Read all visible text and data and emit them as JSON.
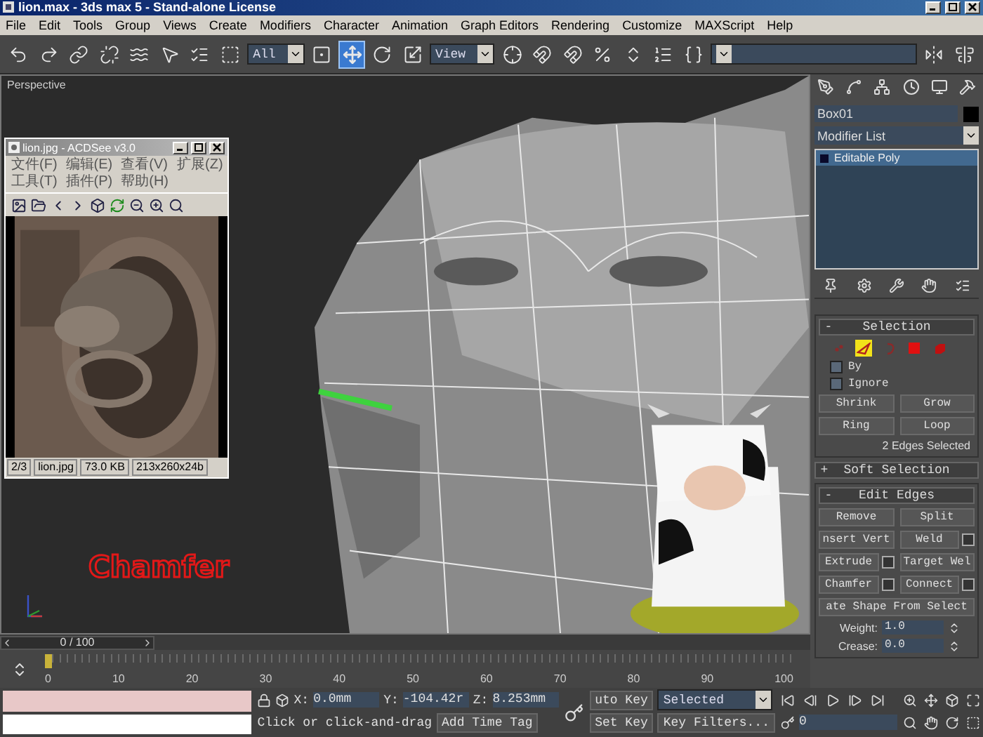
{
  "window": {
    "title": "lion.max - 3ds max 5 - Stand-alone License"
  },
  "menu": [
    "File",
    "Edit",
    "Tools",
    "Group",
    "Views",
    "Create",
    "Modifiers",
    "Character",
    "Animation",
    "Graph Editors",
    "Rendering",
    "Customize",
    "MAXScript",
    "Help"
  ],
  "toolbar": [
    {
      "kind": "undo",
      "selected": false
    },
    {
      "kind": "redo",
      "selected": false
    },
    {
      "kind": "link",
      "selected": false
    },
    {
      "kind": "unlink",
      "selected": false
    },
    {
      "kind": "bind",
      "selected": false
    },
    {
      "kind": "select",
      "selected": false
    },
    {
      "kind": "select-by-name",
      "selected": false
    },
    {
      "kind": "region",
      "selected": false
    },
    {
      "kind": "dropdown",
      "value": "All"
    },
    {
      "kind": "crossing",
      "selected": false
    },
    {
      "kind": "move",
      "selected": true
    },
    {
      "kind": "rotate",
      "selected": false
    },
    {
      "kind": "scale",
      "selected": false
    },
    {
      "kind": "dropdown",
      "value": "View"
    },
    {
      "kind": "pivot",
      "selected": false
    },
    {
      "kind": "snap",
      "selected": false
    },
    {
      "kind": "angle-snap",
      "selected": false
    },
    {
      "kind": "percent-snap",
      "selected": false
    },
    {
      "kind": "spinner-snap",
      "selected": false
    },
    {
      "kind": "named-sets",
      "selected": false
    },
    {
      "kind": "braces",
      "selected": false
    },
    {
      "kind": "dropdown"
    },
    {
      "kind": "mirror",
      "selected": false
    },
    {
      "kind": "align",
      "selected": false
    }
  ],
  "viewport": {
    "label": "Perspective",
    "overlay_text": "Chamfer"
  },
  "image_viewer": {
    "title": "lion.jpg - ACDSee v3.0",
    "menu": [
      "文件(F)",
      "编辑(E)",
      "查看(V)",
      "扩展(Z)",
      "工具(T)",
      "插件(P)",
      "帮助(H)"
    ],
    "status": [
      "2/3",
      "lion.jpg",
      "73.0 KB",
      "213x260x24b"
    ]
  },
  "command_panel": {
    "object_name": "Box01",
    "modifier_list": "Modifier List",
    "stack": [
      {
        "label": "Editable Poly",
        "selected": true
      }
    ],
    "selection": {
      "sign": "-",
      "title": "Selection",
      "levels": [
        {
          "kind": "vertex",
          "selected": false
        },
        {
          "kind": "edge",
          "selected": true
        },
        {
          "kind": "border",
          "selected": false
        },
        {
          "kind": "polygon",
          "selected": false
        },
        {
          "kind": "element",
          "selected": false
        }
      ],
      "checkboxes": [
        {
          "label": "By",
          "checked": false
        },
        {
          "label": "Ignore",
          "checked": false
        }
      ],
      "buttons": [
        "Shrink",
        "Grow",
        "Ring",
        "Loop"
      ],
      "info": "2 Edges Selected"
    },
    "soft_selection": {
      "sign": "+",
      "title": "Soft Selection"
    },
    "edit_edges": {
      "sign": "-",
      "title": "Edit Edges",
      "buttons": [
        {
          "label": "Remove",
          "settings": false
        },
        {
          "label": "Split",
          "settings": false
        },
        {
          "label": "nsert Vert",
          "settings": false
        },
        {
          "label": "Weld",
          "settings": true
        },
        {
          "label": "Extrude",
          "settings": true
        },
        {
          "label": "Target Wel",
          "settings": false
        },
        {
          "label": "Chamfer",
          "settings": true
        },
        {
          "label": "Connect",
          "settings": true
        }
      ],
      "wide_button": "ate Shape From Select",
      "weight": {
        "label": "Weight:",
        "value": "1.0"
      },
      "crease": {
        "label": "Crease:",
        "value": "0.0"
      }
    }
  },
  "timeline": {
    "frame": "0 / 100",
    "level": 0,
    "ticks": [
      "0",
      "10",
      "20",
      "30",
      "40",
      "50",
      "60",
      "70",
      "80",
      "90",
      "100"
    ]
  },
  "status_bar": {
    "x": {
      "label": "X:",
      "value": "0.0mm"
    },
    "y": {
      "label": "Y:",
      "value": "-104.42r"
    },
    "z": {
      "label": "Z:",
      "value": "8.253mm"
    },
    "prompt": "Click or click-and-drag",
    "time_tag": "Add Time Tag",
    "auto_key": "uto Key",
    "set_key": "Set Key",
    "key_mode": "Selected",
    "key_filters": "Key Filters...",
    "current_frame": "0"
  }
}
